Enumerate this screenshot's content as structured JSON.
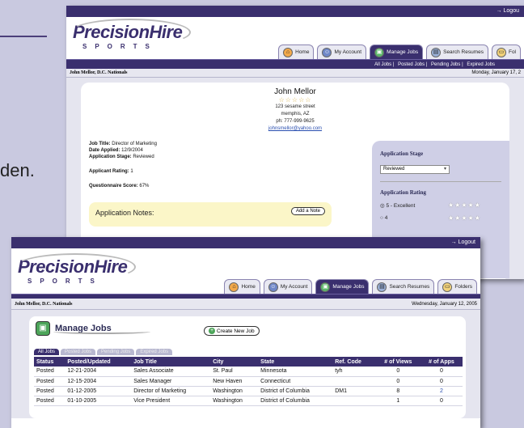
{
  "slide": {
    "fragment_text": "den."
  },
  "back": {
    "topbar": {
      "logout": "→ Logou"
    },
    "logo": {
      "brand": "PrecisionHire",
      "sub": "SPORTS"
    },
    "tabs": [
      {
        "label": "Home",
        "icon": "home-icon"
      },
      {
        "label": "My Account",
        "icon": "account-icon"
      },
      {
        "label": "Manage Jobs",
        "icon": "jobs-icon",
        "active": true
      },
      {
        "label": "Search Resumes",
        "icon": "search-icon"
      },
      {
        "label": "Fol",
        "icon": "folder-icon"
      }
    ],
    "subnav": [
      "All Jobs",
      "Posted Jobs",
      "Pending Jobs",
      "Expired Jobs"
    ],
    "user": "John Mellor, D.C. Nationals",
    "date": "Monday, January 17, 2",
    "applicant": {
      "name": "John Mellor",
      "stars": "☆☆☆☆☆",
      "street": "123 sesame street",
      "city": "memphis, AZ",
      "phone": "ph: 777-999-9625",
      "email": "johnsmellor@yahoo.com"
    },
    "details": {
      "job_title_label": "Job Title:",
      "job_title": "Director of Marketing",
      "date_label": "Date Applied:",
      "date": "12/9/2004",
      "stage_label": "Application Stage:",
      "stage": "Reviewed",
      "rating_label": "Applicant Rating:",
      "rating": "1",
      "score_label": "Questionnaire Score:",
      "score": "67%"
    },
    "notes": {
      "label": "Application Notes:",
      "add_button": "Add a Note"
    },
    "stage_panel": {
      "stage_heading": "Application Stage",
      "stage_value": "Reviewed",
      "rating_heading": "Application Rating",
      "option_excellent": "5 - Excellent",
      "option_4": "4",
      "option_stars": "★★★★★"
    }
  },
  "front": {
    "topbar": {
      "logout": "→ Logout"
    },
    "logo": {
      "brand": "PrecisionHire",
      "sub": "SPORTS"
    },
    "tabs": [
      {
        "label": "Home",
        "icon": "home-icon"
      },
      {
        "label": "My Account",
        "icon": "account-icon"
      },
      {
        "label": "Manage Jobs",
        "icon": "jobs-icon",
        "active": true
      },
      {
        "label": "Search Resumes",
        "icon": "search-icon"
      },
      {
        "label": "Folders",
        "icon": "folder-icon"
      }
    ],
    "user": "John Mellor, D.C. Nationals",
    "date": "Wednesday, January 12, 2005",
    "manage_jobs_title": "Manage Jobs",
    "create_button": "Create New Job",
    "job_tabs": [
      "All Jobs",
      "Posted Jobs",
      "Pending Jobs",
      "Expired Jobs"
    ],
    "columns": [
      "Status",
      "Posted/Updated",
      "Job Title",
      "City",
      "State",
      "Ref. Code",
      "# of Views",
      "# of Apps"
    ],
    "rows": [
      [
        "Posted",
        "12-21-2004",
        "Sales Associate",
        "St. Paul",
        "Minnesota",
        "tyh",
        "0",
        "0"
      ],
      [
        "Posted",
        "12-15-2004",
        "Sales Manager",
        "New Haven",
        "Connecticut",
        "",
        "0",
        "0"
      ],
      [
        "Posted",
        "01-12-2005",
        "Director of Marketing",
        "Washington",
        "District of Columbia",
        "DM1",
        "8",
        "2"
      ],
      [
        "Posted",
        "01-10-2005",
        "Vice President",
        "Washington",
        "District of Columbia",
        "",
        "1",
        "0"
      ]
    ]
  }
}
